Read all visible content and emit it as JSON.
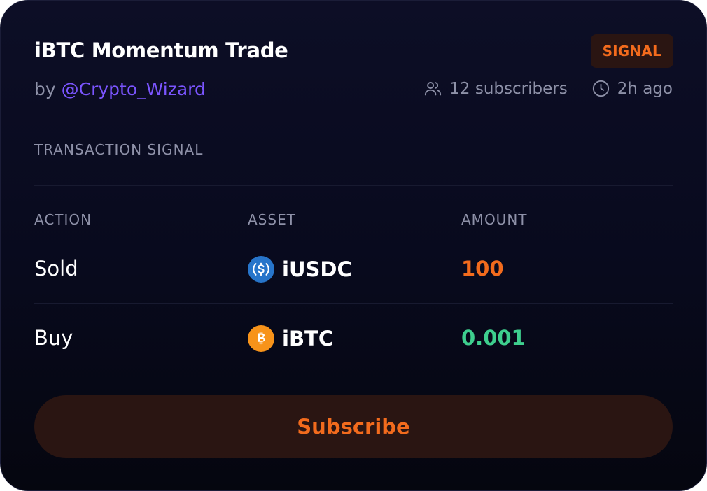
{
  "card": {
    "title": "iBTC Momentum Trade",
    "badge": "SIGNAL",
    "by_prefix": "by ",
    "author": "@Crypto_Wizard",
    "subscribers": "12 subscribers",
    "time_ago": "2h ago",
    "section_label": "TRANSACTION SIGNAL"
  },
  "table": {
    "headers": [
      "ACTION",
      "ASSET",
      "AMOUNT"
    ],
    "rows": [
      {
        "action": "Sold",
        "asset": "iUSDC",
        "asset_icon": "usdc-icon",
        "amount": "100",
        "amount_color": "#f26b1d"
      },
      {
        "action": "Buy",
        "asset": "iBTC",
        "asset_icon": "btc-icon",
        "amount": "0.001",
        "amount_color": "#3ecf8e"
      }
    ]
  },
  "subscribe_label": "Subscribe",
  "colors": {
    "accent_orange": "#f26b1d",
    "author_purple": "#7b55ff",
    "buy_green": "#3ecf8e",
    "muted": "#8e91a8",
    "usdc_blue": "#2775ca",
    "btc_orange": "#f7931a"
  }
}
